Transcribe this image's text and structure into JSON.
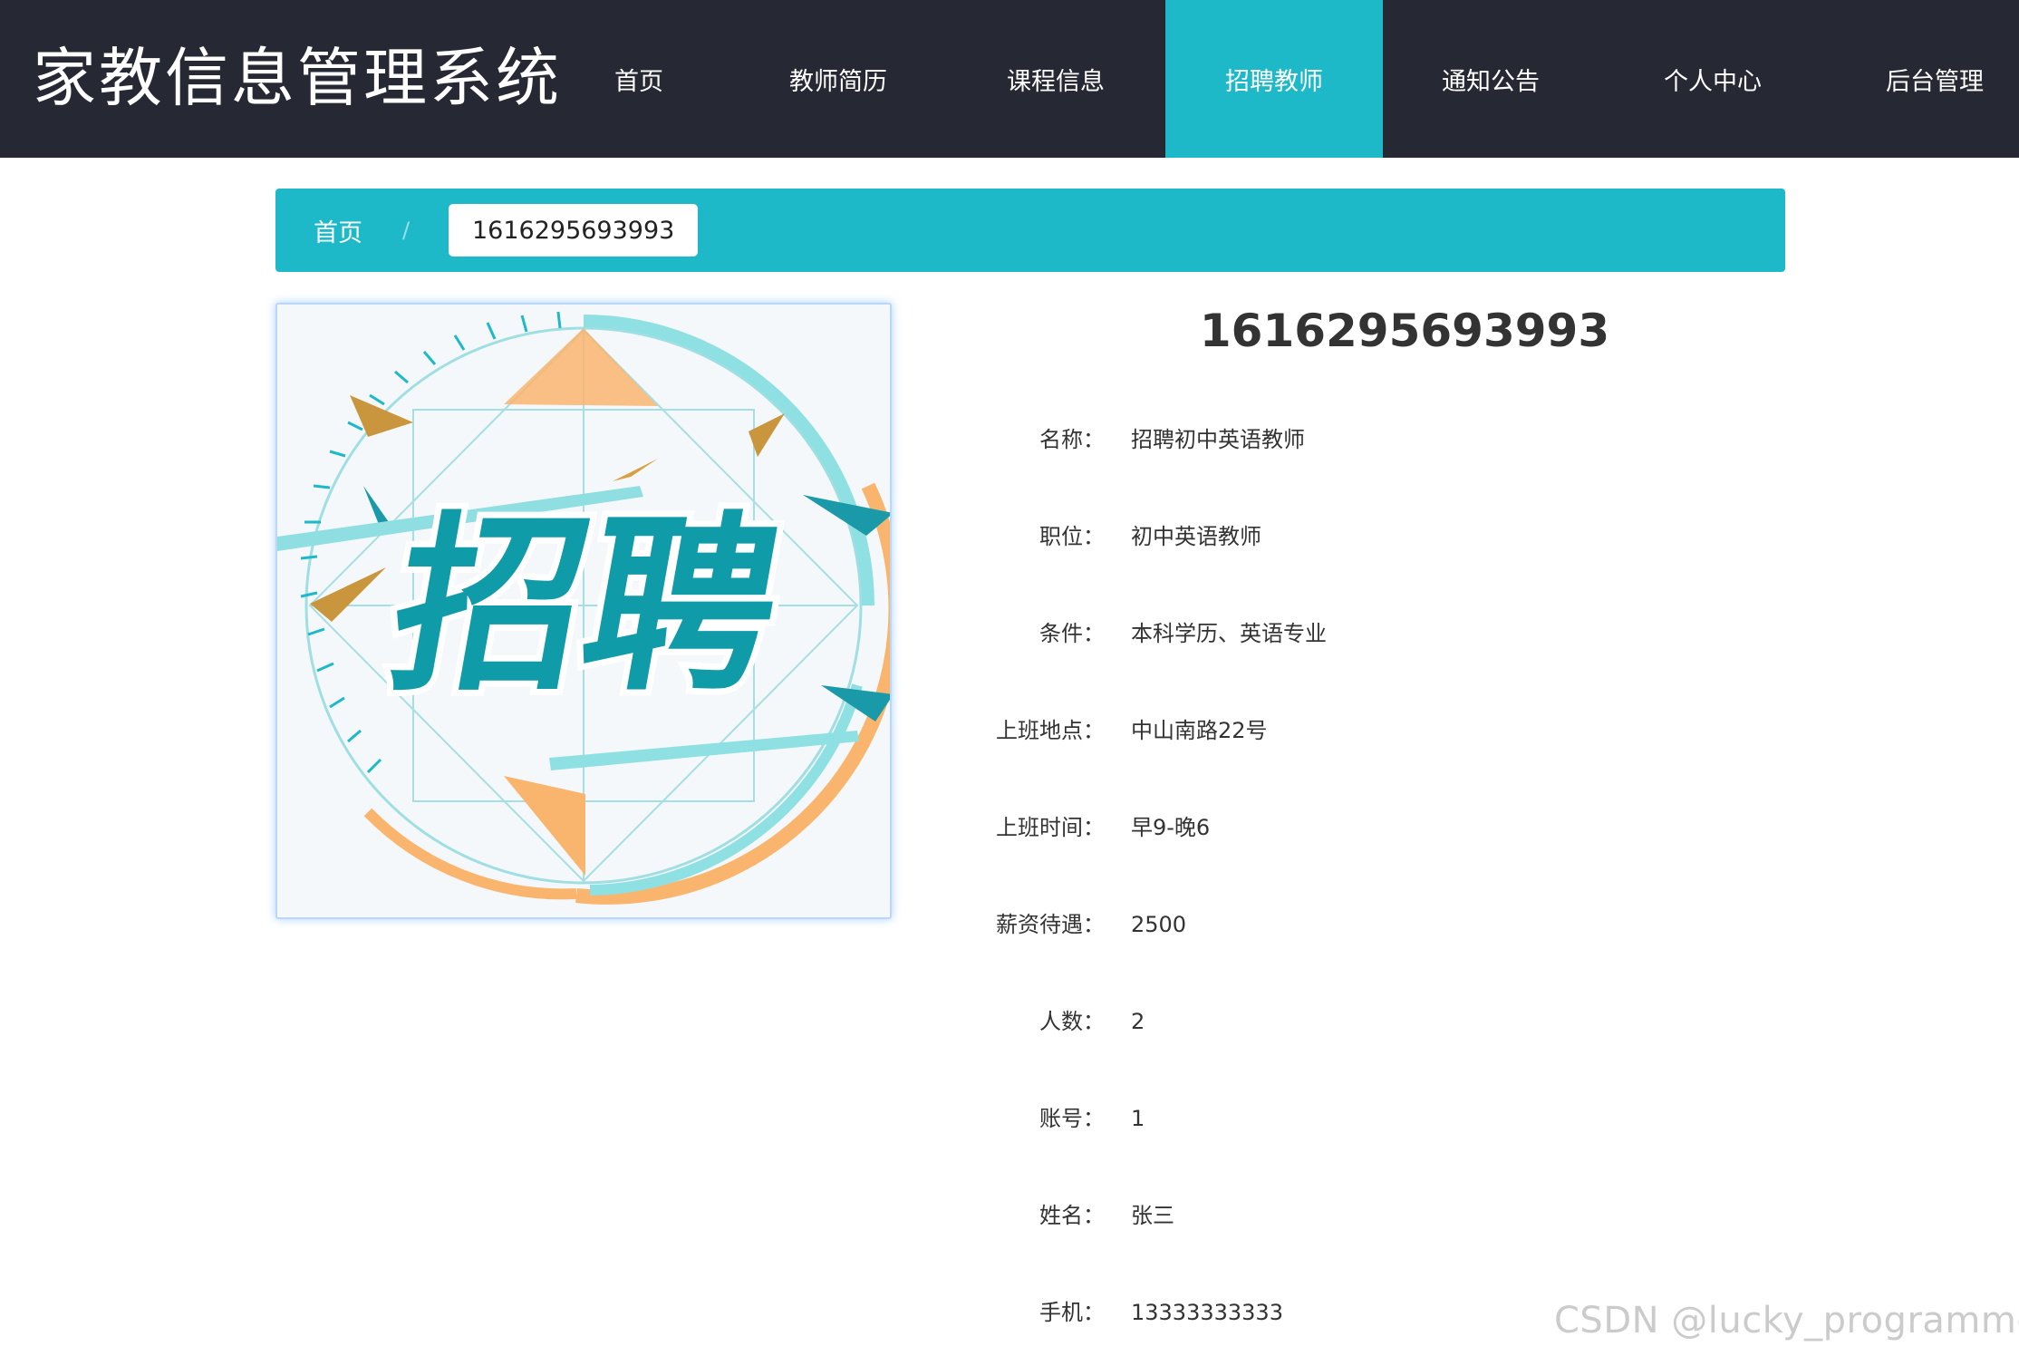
{
  "header": {
    "site_title": "家教信息管理系统",
    "nav": [
      {
        "label": "首页",
        "active": false
      },
      {
        "label": "教师简历",
        "active": false
      },
      {
        "label": "课程信息",
        "active": false
      },
      {
        "label": "招聘教师",
        "active": true
      },
      {
        "label": "通知公告",
        "active": false
      },
      {
        "label": "个人中心",
        "active": false
      },
      {
        "label": "后台管理",
        "active": false
      }
    ]
  },
  "breadcrumb": {
    "home": "首页",
    "separator": "/",
    "current": "1616295693993"
  },
  "poster": {
    "text": "招聘",
    "icon": "recruitment-poster-image"
  },
  "detail": {
    "title": "1616295693993",
    "colon": "：",
    "fields": [
      {
        "label": "名称",
        "value": "招聘初中英语教师"
      },
      {
        "label": "职位",
        "value": "初中英语教师"
      },
      {
        "label": "条件",
        "value": "本科学历、英语专业"
      },
      {
        "label": "上班地点",
        "value": "中山南路22号"
      },
      {
        "label": "上班时间",
        "value": "早9-晚6"
      },
      {
        "label": "薪资待遇",
        "value": "2500"
      },
      {
        "label": "人数",
        "value": "2"
      },
      {
        "label": "账号",
        "value": "1"
      },
      {
        "label": "姓名",
        "value": "张三"
      },
      {
        "label": "手机",
        "value": "13333333333"
      }
    ]
  },
  "watermark": "CSDN @lucky_programmer",
  "colors": {
    "nav_bg": "#262833",
    "accent": "#1eb9c8",
    "poster_teal": "#0f9ba8",
    "poster_orange": "#f9b56e"
  }
}
